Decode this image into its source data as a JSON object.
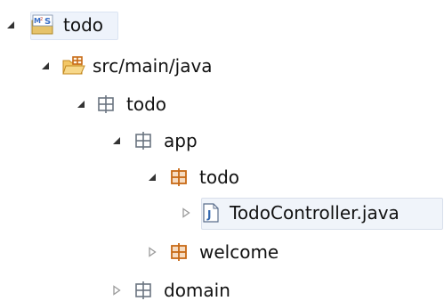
{
  "colors": {
    "package_outline": "#6b7480",
    "package_resource": "#c86a16",
    "folder": "#d49a2a",
    "twisty_expanded": "#333333",
    "twisty_collapsed": "#9a9a9a",
    "java_file": "#3267b0",
    "project_icon": "#3a6fc7"
  },
  "tree": {
    "project": {
      "label": "todo",
      "icon": "maven-project-icon",
      "expanded": true
    },
    "source_folder": {
      "label": "src/main/java",
      "icon": "source-folder-icon",
      "expanded": true
    },
    "pkg_todo": {
      "label": "todo",
      "icon": "package-icon",
      "expanded": true
    },
    "pkg_app": {
      "label": "app",
      "icon": "package-icon",
      "expanded": true
    },
    "pkg_app_todo": {
      "label": "todo",
      "icon": "package-with-content-icon",
      "expanded": true
    },
    "file_controller": {
      "label": "TodoController.java",
      "icon": "java-file-icon",
      "expanded": false,
      "selected": true
    },
    "pkg_welcome": {
      "label": "welcome",
      "icon": "package-with-content-icon",
      "expanded": false
    },
    "pkg_domain": {
      "label": "domain",
      "icon": "package-icon",
      "expanded": false
    }
  }
}
